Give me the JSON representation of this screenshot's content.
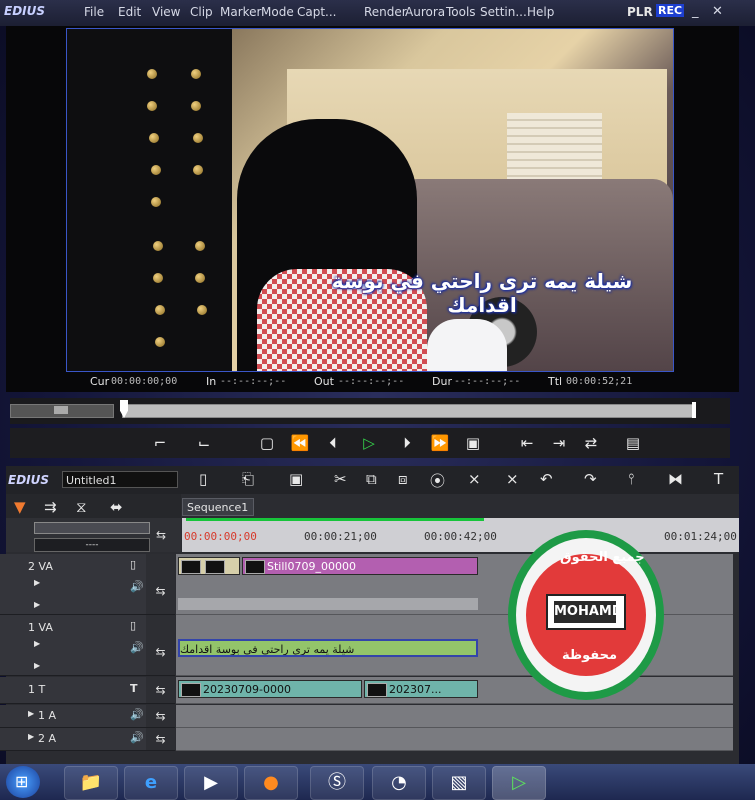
{
  "titlebar": {
    "app_name": "EDIUS",
    "menus": [
      "File",
      "Edit",
      "View",
      "Clip",
      "Marker",
      "Mode",
      "Capt...",
      "Render",
      "Aurora",
      "Tools",
      "Settin...",
      "Help"
    ],
    "plr": "PLR",
    "rec": "REC",
    "minimize": "_",
    "close": "✕"
  },
  "player": {
    "subtitle": "شيلة يمه ترى راحتي في بوسة اقدامك",
    "cur_label": "Cur",
    "cur_value": "00:00:00;00",
    "in_label": "In",
    "in_value": "--:--:--;--",
    "out_label": "Out",
    "out_value": "--:--:--;--",
    "dur_label": "Dur",
    "dur_value": "--:--:--;--",
    "ttl_label": "Ttl",
    "ttl_value": "00:00:52;21"
  },
  "timeline": {
    "app_name": "EDIUS",
    "project_name": "Untitled1",
    "sequence_tab": "Sequence1",
    "ruler": [
      "00:00:00;00",
      "00:00:21;00",
      "00:00:42;00",
      "00:01:24;00"
    ],
    "dropdown_value": "----",
    "tracks": [
      {
        "name": "2 VA",
        "clip_label": "Still0709_00000"
      },
      {
        "name": "1 VA",
        "clip_label": "شيلة يمه ترى راحتي في بوسة اقدامك"
      },
      {
        "name": "1 T",
        "clip_label_1": "20230709-0000",
        "clip_label_2": "202307..."
      },
      {
        "name": "1 A"
      },
      {
        "name": "2 A"
      }
    ]
  },
  "watermark": {
    "name": "MOHAMD",
    "arabic_top": "جميع الحقوق",
    "arabic_side": "محفوظة"
  },
  "colors": {
    "accent": "#3a56c8",
    "clip_purple": "#b35fb0",
    "clip_green": "#93c46a",
    "clip_teal": "#6fb4aa",
    "ruler_green": "#17c43a"
  }
}
